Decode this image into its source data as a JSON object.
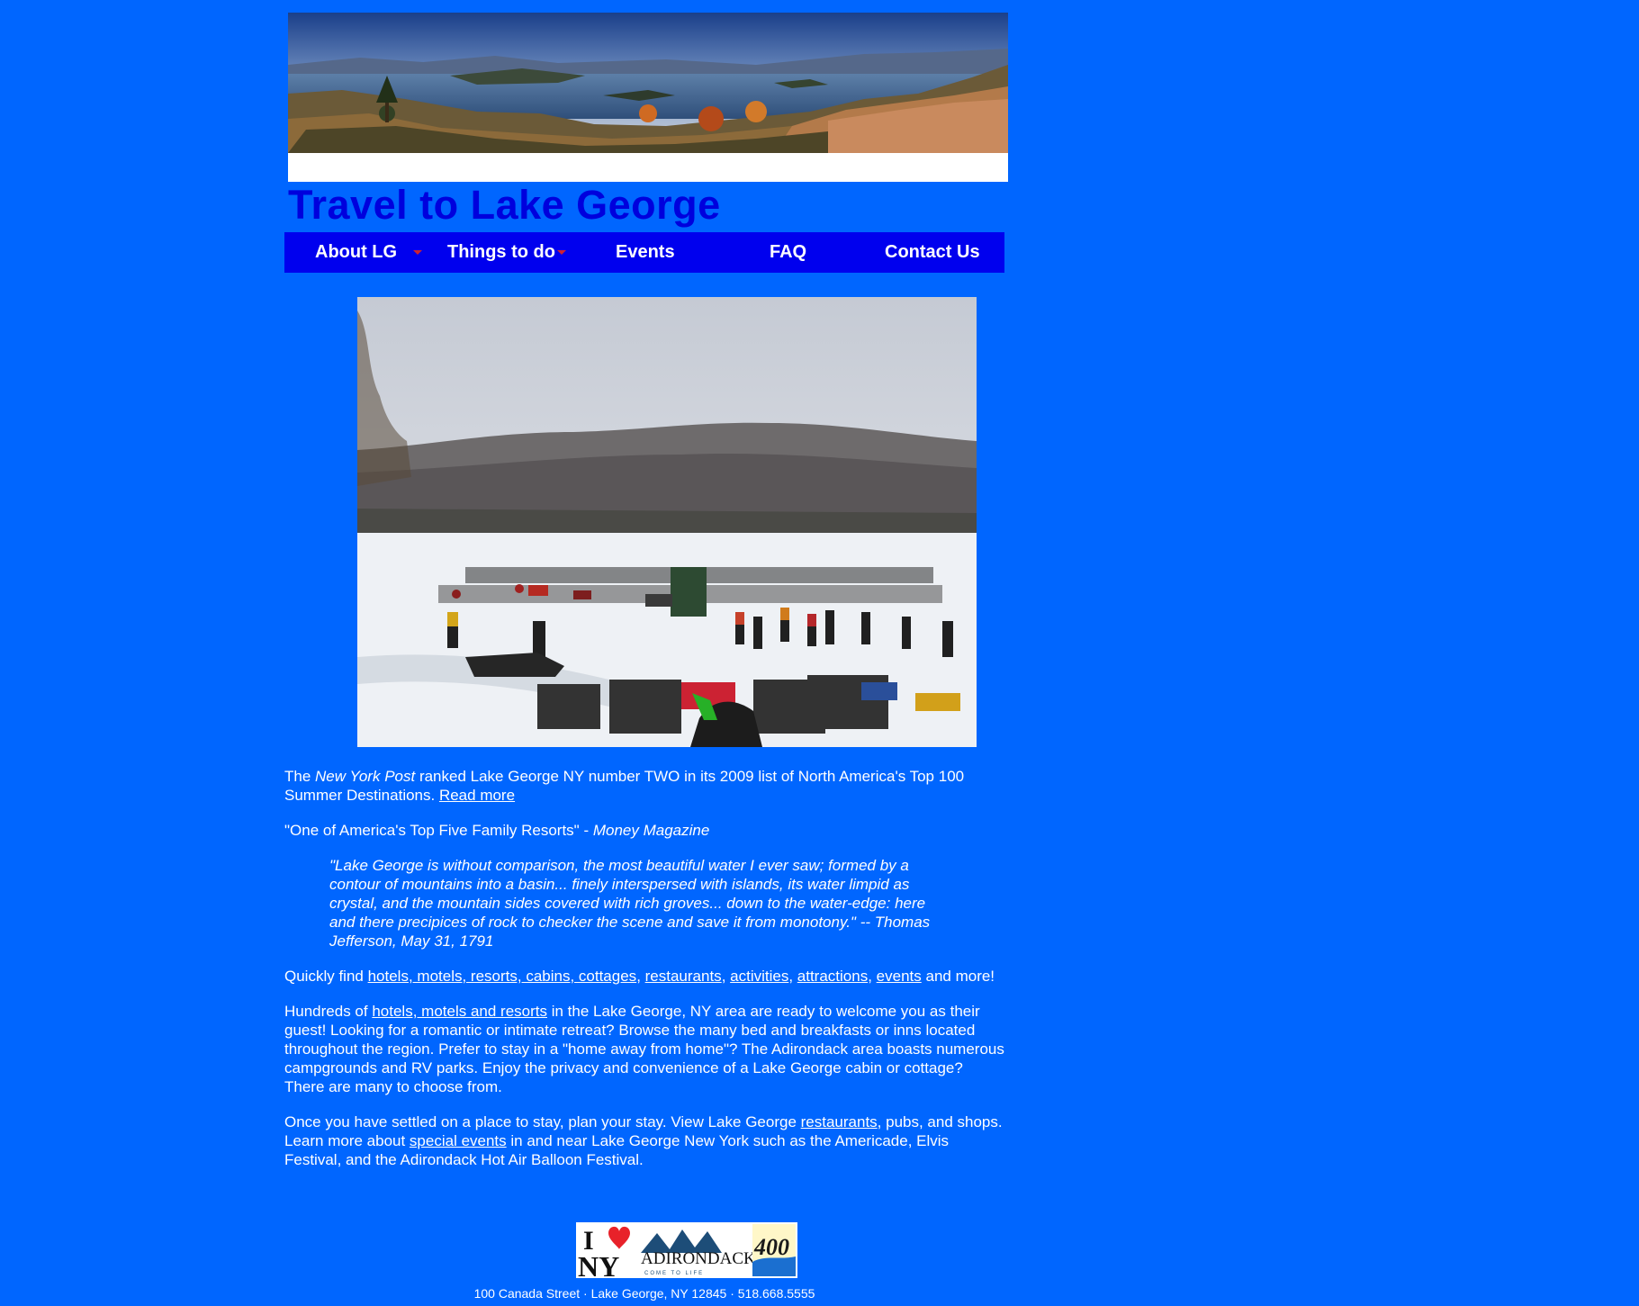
{
  "site": {
    "title": "Travel to Lake George"
  },
  "nav": {
    "items": [
      {
        "label": "About LG",
        "has_dropdown": true
      },
      {
        "label": "Things to do",
        "has_dropdown": true
      },
      {
        "label": "Events",
        "has_dropdown": false
      },
      {
        "label": "FAQ",
        "has_dropdown": false
      },
      {
        "label": "Contact Us",
        "has_dropdown": false
      }
    ]
  },
  "content": {
    "p1": {
      "t1": "The ",
      "publication": "New York Post",
      "t2": " ranked Lake George NY number TWO in its 2009 list of North America's Top 100 Summer Destinations. ",
      "read_more": "Read more"
    },
    "p2": {
      "quote": "\"One of America's Top Five Family Resorts\" - ",
      "source": "Money Magazine"
    },
    "jefferson_quote": "\"Lake George is without comparison, the most beautiful water I ever saw; formed by a contour of mountains into a basin... finely interspersed with islands, its water limpid as crystal, and the mountain sides covered with rich groves... down to the water-edge: here and there precipices of rock to checker the scene and save it from monotony.\" -- Thomas Jefferson, May 31, 1791",
    "p3": {
      "t1": "Quickly find ",
      "link_lodging": "hotels, motels, resorts, cabins, cottages",
      "sep1": ", ",
      "link_restaurants": "restaurants",
      "sep2": ", ",
      "link_activities": "activities",
      "sep3": ", ",
      "link_attractions": "attractions",
      "sep4": ", ",
      "link_events": "events",
      "t2": " and more!"
    },
    "p4": {
      "t1": "Hundreds of ",
      "link_hotels": "hotels, motels and resorts",
      "t2": " in the Lake George, NY area are ready to welcome you as their guest! Looking for a romantic or intimate retreat? Browse the many bed and breakfasts or inns located throughout the region. Prefer to stay in a \"home away from home\"? The Adirondack area boasts numerous campgrounds and RV parks. Enjoy the privacy and convenience of a Lake George cabin or cottage? There are many to choose from."
    },
    "p5": {
      "t1": "Once you have settled on a place to stay, plan your stay. View Lake George ",
      "link_restaurants": "restaurants",
      "t2": ", pubs, and shops. Learn more about ",
      "link_events": "special events",
      "t3": " in and near Lake George New York such as the Americade, Elvis Festival, and the Adirondack Hot Air Balloon Festival."
    }
  },
  "footer": {
    "logo_i": "I",
    "logo_ny": "NY",
    "logo_adk": "ADIRONDACKS",
    "logo_tagline": "COME TO LIFE",
    "logo_400": "400",
    "address": "100 Canada Street · Lake George, NY 12845 · 518.668.5555"
  }
}
